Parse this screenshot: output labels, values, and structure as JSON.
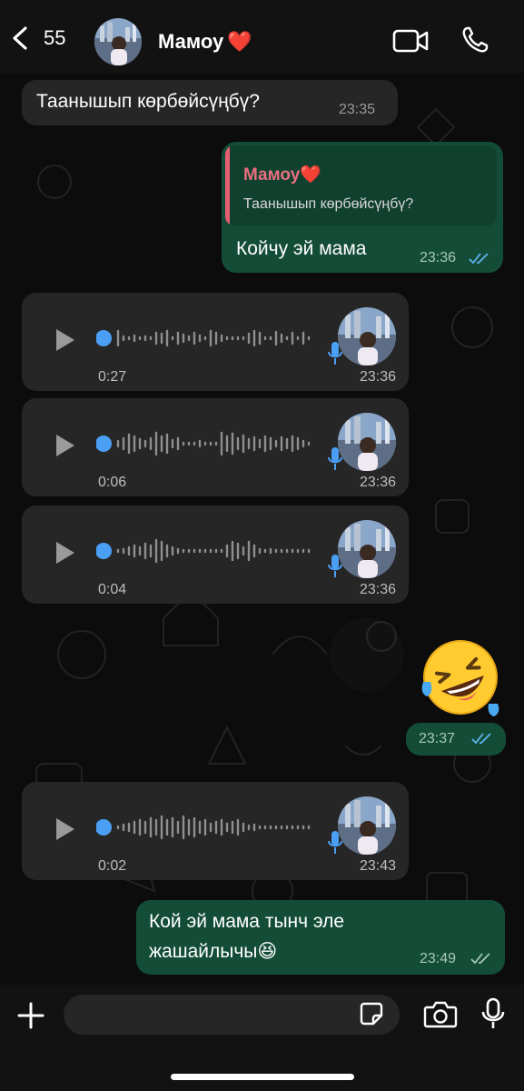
{
  "header": {
    "back_count": "55",
    "contact_name": "Мамоу",
    "contact_emoji": "❤️"
  },
  "messages": {
    "m1": {
      "text": "Таанышып көрбөйсүңбү?",
      "time": "23:35"
    },
    "m2": {
      "reply_name": "Мамоу",
      "reply_emoji": "❤️",
      "reply_text": "Таанышып көрбөйсүңбү?",
      "text": "Койчу эй мама",
      "time": "23:36"
    },
    "voice1": {
      "duration": "0:27",
      "time": "23:36"
    },
    "voice2": {
      "duration": "0:06",
      "time": "23:36"
    },
    "voice3": {
      "duration": "0:04",
      "time": "23:36"
    },
    "m_emoji": {
      "emoji": "🤣",
      "time": "23:37"
    },
    "voice4": {
      "duration": "0:02",
      "time": "23:43"
    },
    "m_last": {
      "line1": "Кой эй мама тынч эле",
      "line2": "жашайлычы",
      "emoji": "😆",
      "time": "23:49"
    }
  },
  "colors": {
    "incoming": "#262626",
    "outgoing": "#144d37",
    "accent_blue": "#4a9ff5",
    "read_tick": "#5fb3f0",
    "reply_accent": "#e85d72"
  }
}
